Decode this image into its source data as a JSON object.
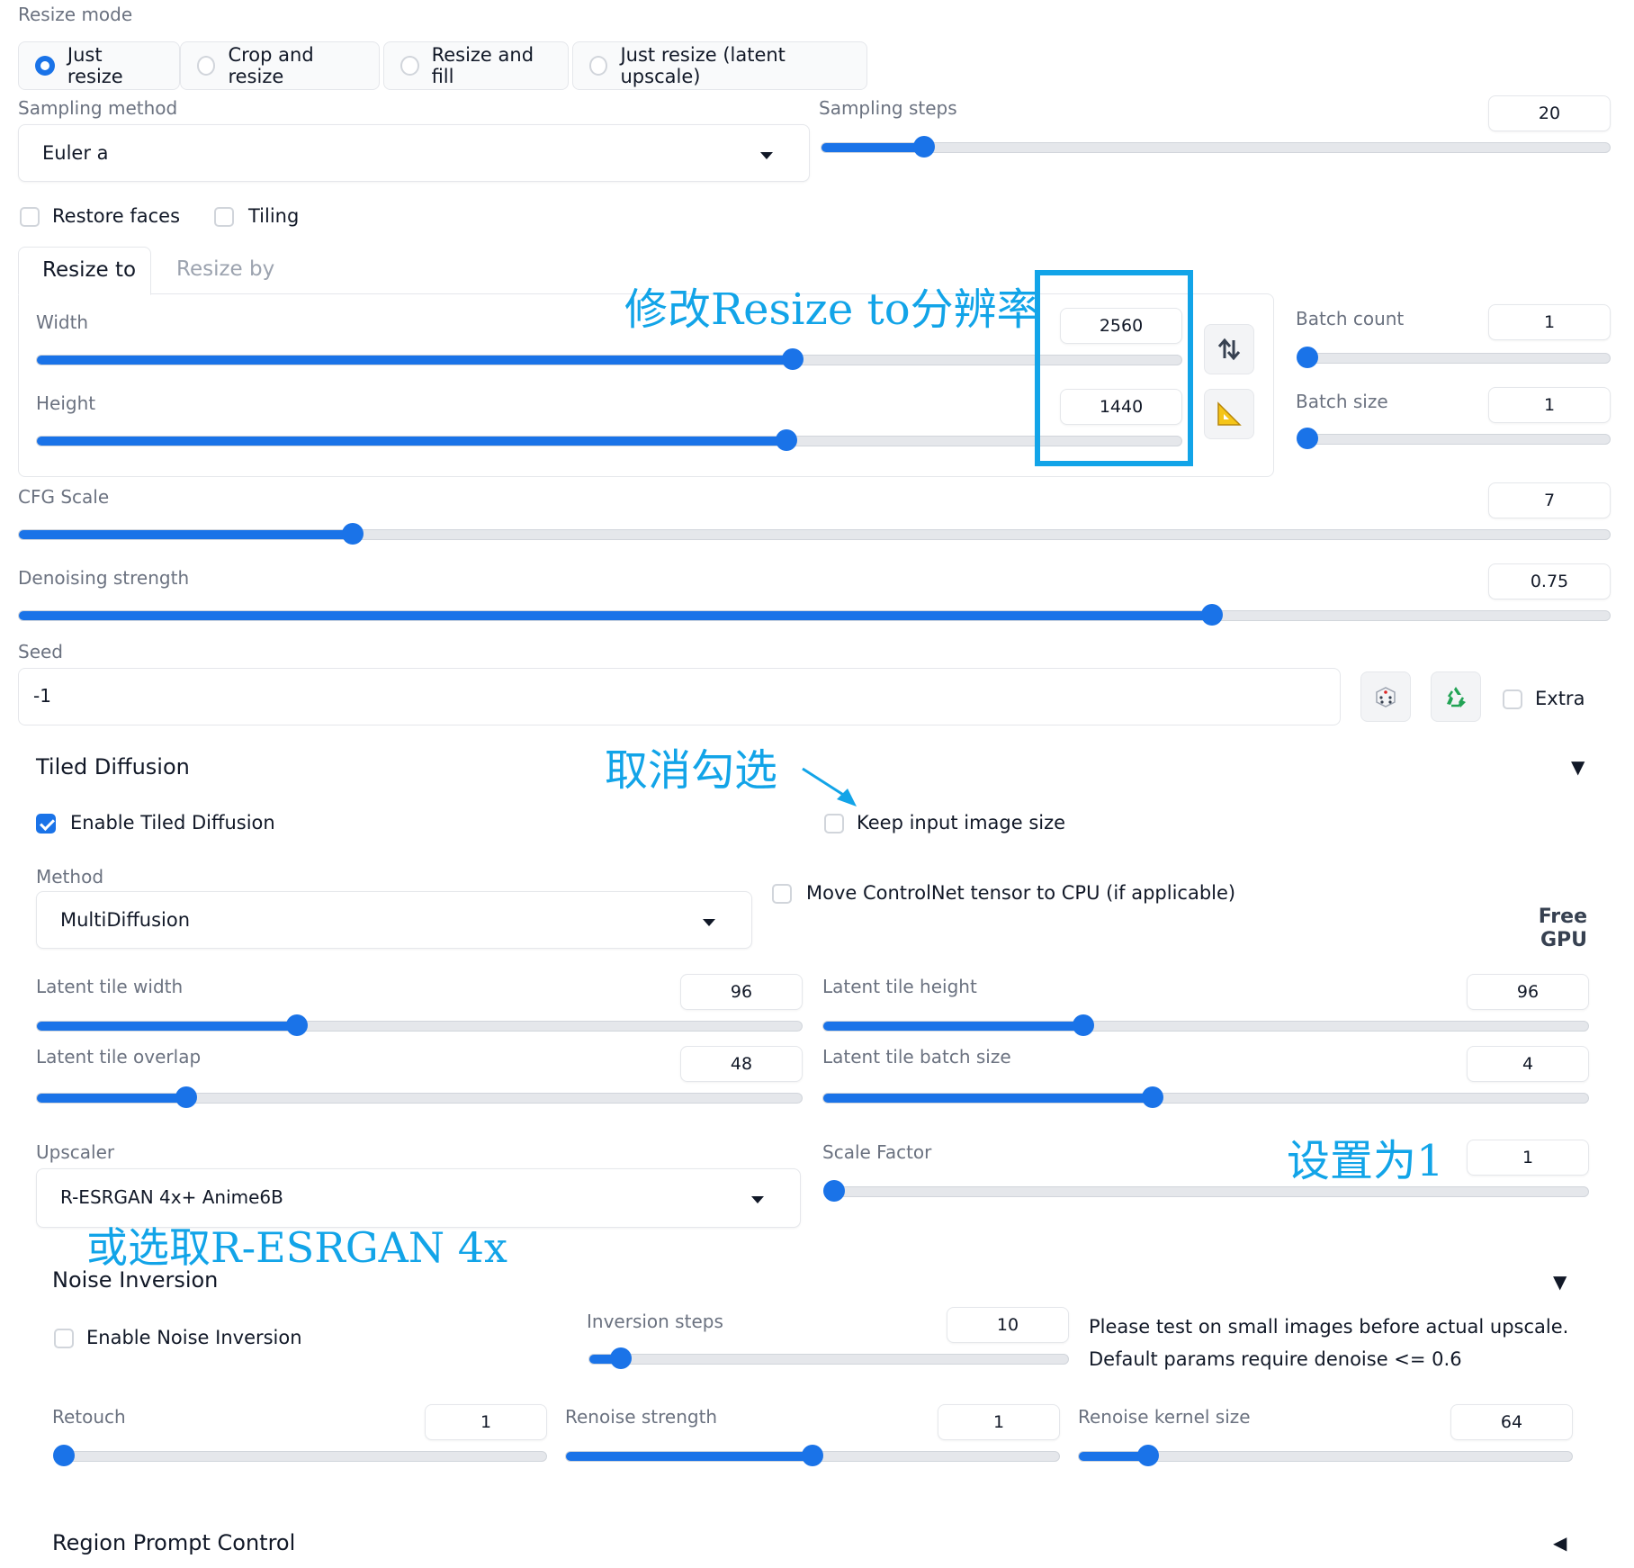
{
  "resize_mode": {
    "label": "Resize mode",
    "options": [
      {
        "label": "Just resize",
        "selected": true
      },
      {
        "label": "Crop and resize",
        "selected": false
      },
      {
        "label": "Resize and fill",
        "selected": false
      },
      {
        "label": "Just resize (latent upscale)",
        "selected": false
      }
    ]
  },
  "sampling_method": {
    "label": "Sampling method",
    "value": "Euler a"
  },
  "sampling_steps": {
    "label": "Sampling steps",
    "value": "20",
    "fraction": 0.13
  },
  "restore_faces": {
    "label": "Restore faces",
    "checked": false
  },
  "tiling": {
    "label": "Tiling",
    "checked": false
  },
  "resize_tabs": {
    "active": "Resize to",
    "inactive": "Resize by"
  },
  "width": {
    "label": "Width",
    "value": "2560",
    "fraction": 0.66
  },
  "height": {
    "label": "Height",
    "value": "1440",
    "fraction": 0.655
  },
  "batch_count": {
    "label": "Batch count",
    "value": "1",
    "fraction": 0.0
  },
  "batch_size": {
    "label": "Batch size",
    "value": "1",
    "fraction": 0.0
  },
  "cfg_scale": {
    "label": "CFG Scale",
    "value": "7",
    "fraction": 0.21
  },
  "denoising": {
    "label": "Denoising strength",
    "value": "0.75",
    "fraction": 0.75
  },
  "seed": {
    "label": "Seed",
    "value": "-1",
    "extra_label": "Extra"
  },
  "tiled_diffusion": {
    "title": "Tiled Diffusion",
    "enable_label": "Enable Tiled Diffusion",
    "keep_size_label": "Keep input image size",
    "method_label": "Method",
    "method_value": "MultiDiffusion",
    "move_cn_label": "Move ControlNet tensor to CPU (if applicable)",
    "free_gpu": [
      "Free",
      "GPU"
    ],
    "tile_width": {
      "label": "Latent tile width",
      "value": "96",
      "fraction": 0.34
    },
    "tile_height": {
      "label": "Latent tile height",
      "value": "96",
      "fraction": 0.34
    },
    "tile_overlap": {
      "label": "Latent tile overlap",
      "value": "48",
      "fraction": 0.195
    },
    "tile_batch": {
      "label": "Latent tile batch size",
      "value": "4",
      "fraction": 0.43
    },
    "upscaler_label": "Upscaler",
    "upscaler_value": "R-ESRGAN 4x+ Anime6B",
    "scale_factor": {
      "label": "Scale Factor",
      "value": "1",
      "fraction": 0.0
    }
  },
  "noise_inversion": {
    "title": "Noise Inversion",
    "enable_label": "Enable Noise Inversion",
    "inversion_steps": {
      "label": "Inversion steps",
      "value": "10",
      "fraction": 0.065
    },
    "note_lines": [
      "Please test on small images before actual upscale.",
      "Default params require denoise <= 0.6"
    ],
    "retouch": {
      "label": "Retouch",
      "value": "1",
      "fraction": 0.0
    },
    "renoise_strength": {
      "label": "Renoise strength",
      "value": "1",
      "fraction": 0.5
    },
    "renoise_kernel": {
      "label": "Renoise kernel size",
      "value": "64",
      "fraction": 0.14
    }
  },
  "region_prompt": {
    "title": "Region Prompt Control"
  },
  "annotations": {
    "resize_note": "修改Resize to分辨率",
    "uncheck_note": "取消勾选",
    "set_one_note": "设置为1",
    "alt_upscaler_note": "或选取R-ESRGAN 4x"
  },
  "colors": {
    "accent": "#1a73e8",
    "annotation": "#12a4e8"
  },
  "icons": {
    "swap": "swap-arrows-icon",
    "ruler": "triangle-ruler-icon",
    "dice": "dice-icon",
    "recycle": "recycle-icon"
  }
}
